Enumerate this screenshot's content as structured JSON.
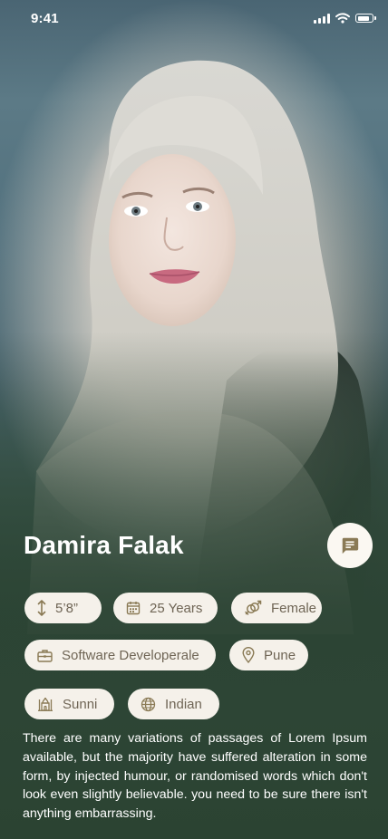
{
  "status_bar": {
    "time": "9:41"
  },
  "profile": {
    "name": "Damira Falak",
    "height": "5’8”",
    "age": "25 Years",
    "gender": "Female",
    "profession": "Software Developerale",
    "location": "Pune",
    "sect": "Sunni",
    "nationality": "Indian",
    "bio": "There are many variations of passages of Lorem Ipsum available, but the majority have suffered alteration in some form, by injected humour, or randomised words which don't look even slightly believable. you need to be sure there isn't anything embarrassing."
  },
  "icons": {
    "height": "height-arrows-icon",
    "age": "calendar-icon",
    "gender": "gender-symbol-icon",
    "profession": "briefcase-icon",
    "location": "location-pin-icon",
    "sect": "mosque-icon",
    "nationality": "globe-icon",
    "chat": "chat-icon"
  },
  "colors": {
    "background_green": "#2d4535",
    "chip_bg": "#f5f1ea",
    "chip_text": "#6f6555",
    "chat_icon": "#8a7a55"
  },
  "battery_level": 0.8
}
